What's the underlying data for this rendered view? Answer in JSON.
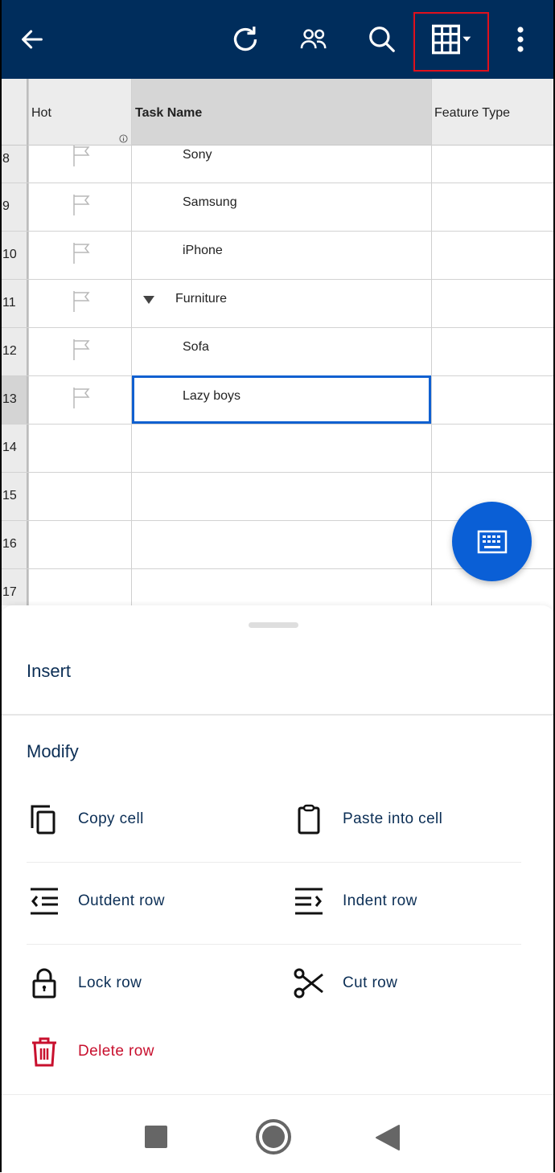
{
  "topbar": {
    "back_icon": "arrow-left-icon",
    "actions": [
      {
        "name": "refresh",
        "icon": "refresh-icon"
      },
      {
        "name": "collaborators",
        "icon": "people-icon"
      },
      {
        "name": "search",
        "icon": "search-icon"
      },
      {
        "name": "view-switcher",
        "icon": "grid-view-dropdown-icon",
        "highlighted": true
      },
      {
        "name": "more",
        "icon": "more-vertical-icon"
      }
    ],
    "background": "#002d5c"
  },
  "grid": {
    "columns": [
      {
        "label": "Hot",
        "has_info_icon": true
      },
      {
        "label": "Task Name",
        "selected": true
      },
      {
        "label": "Feature Type"
      }
    ],
    "rows": [
      {
        "num": "8",
        "flag": true,
        "task": "Sony",
        "indent": 2
      },
      {
        "num": "9",
        "flag": true,
        "task": "Samsung",
        "indent": 2
      },
      {
        "num": "10",
        "flag": true,
        "task": "iPhone",
        "indent": 2
      },
      {
        "num": "11",
        "flag": true,
        "task": "Furniture",
        "indent": 1,
        "collapsible": true
      },
      {
        "num": "12",
        "flag": true,
        "task": "Sofa",
        "indent": 2
      },
      {
        "num": "13",
        "flag": true,
        "task": "Lazy boys",
        "indent": 2,
        "selected": true
      },
      {
        "num": "14",
        "flag": false,
        "task": ""
      },
      {
        "num": "15",
        "flag": false,
        "task": ""
      },
      {
        "num": "16",
        "flag": false,
        "task": ""
      },
      {
        "num": "17",
        "flag": false,
        "task": ""
      }
    ],
    "selection_color": "#1060d0"
  },
  "fab": {
    "icon": "keyboard-icon",
    "color": "#0a5fd6"
  },
  "sheet": {
    "insert_title": "Insert",
    "modify_title": "Modify",
    "actions": {
      "copy_cell": "Copy cell",
      "paste_into_cell": "Paste into cell",
      "outdent_row": "Outdent row",
      "indent_row": "Indent row",
      "lock_row": "Lock row",
      "cut_row": "Cut row",
      "delete_row": "Delete row"
    },
    "text_color": "#0b2e55",
    "danger_color": "#c8102e"
  },
  "navbar": {
    "buttons": [
      "recents",
      "home",
      "back"
    ]
  }
}
